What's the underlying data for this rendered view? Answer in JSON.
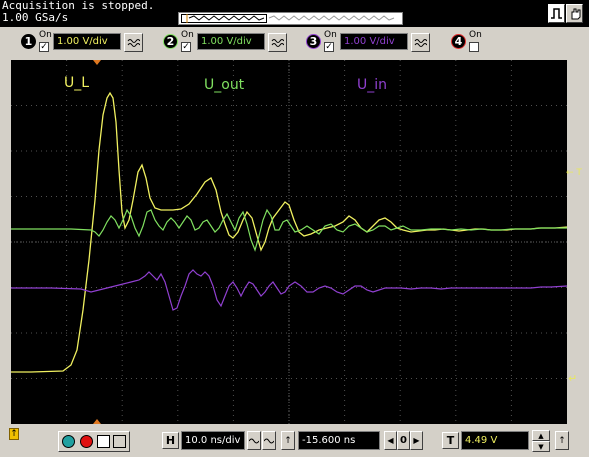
{
  "status": {
    "line1": "Acquisition is stopped.",
    "line2": "1.00 GSa/s"
  },
  "channels": [
    {
      "num": "1",
      "on_label": "On",
      "on": true,
      "scale": "1.00 V/div",
      "color": "#f0f060",
      "trace_label": "U_L"
    },
    {
      "num": "2",
      "on_label": "On",
      "on": true,
      "scale": "1.00 V/div",
      "color": "#80e060",
      "trace_label": "U_out"
    },
    {
      "num": "3",
      "on_label": "On",
      "on": true,
      "scale": "1.00 V/div",
      "color": "#9040d0",
      "trace_label": "U_in"
    },
    {
      "num": "4",
      "on_label": "On",
      "on": false,
      "scale": "",
      "color": "#e03030",
      "trace_label": ""
    }
  ],
  "markers": {
    "trigger_level": "← T",
    "ground_marker": "↵"
  },
  "timebase": {
    "h_label": "H",
    "scale": "10.0 ns/div",
    "delay": "-15.600 ns",
    "zero_label": "0"
  },
  "trigger": {
    "t_label": "T",
    "level": "4.49 V"
  },
  "icons": {
    "run_stop": "run-stop-icon",
    "single": "single-icon",
    "print": "print-icon",
    "sine": "sine-icon"
  }
}
